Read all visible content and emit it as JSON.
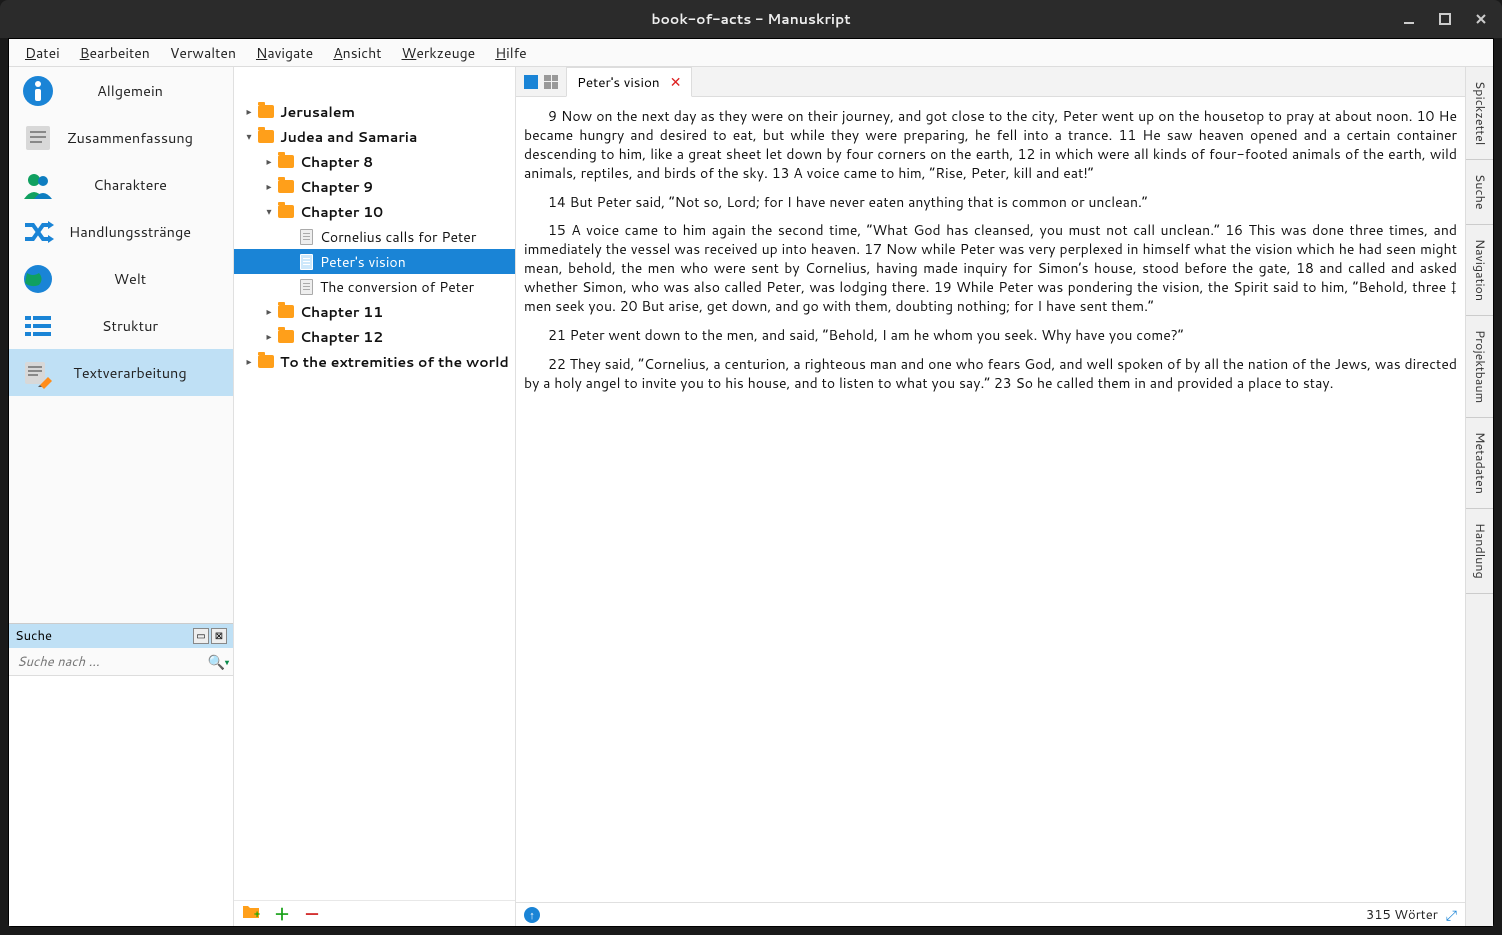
{
  "window": {
    "title": "book-of-acts - Manuskript"
  },
  "menubar": [
    "Datei",
    "Bearbeiten",
    "Verwalten",
    "Navigate",
    "Ansicht",
    "Werkzeuge",
    "Hilfe"
  ],
  "left_nav": {
    "items": [
      {
        "label": "Allgemein",
        "icon": "info"
      },
      {
        "label": "Zusammenfassung",
        "icon": "summary"
      },
      {
        "label": "Charaktere",
        "icon": "people"
      },
      {
        "label": "Handlungsstränge",
        "icon": "shuffle"
      },
      {
        "label": "Welt",
        "icon": "globe"
      },
      {
        "label": "Struktur",
        "icon": "list"
      },
      {
        "label": "Textverarbeitung",
        "icon": "edit"
      }
    ],
    "selected_index": 6
  },
  "search": {
    "title": "Suche",
    "placeholder": "Suche nach ..."
  },
  "tree": [
    {
      "depth": 0,
      "exp": "▸",
      "kind": "folder",
      "bold": true,
      "label": "Jerusalem"
    },
    {
      "depth": 0,
      "exp": "▾",
      "kind": "folder",
      "bold": true,
      "label": "Judea and Samaria"
    },
    {
      "depth": 1,
      "exp": "▸",
      "kind": "folder",
      "bold": true,
      "label": "Chapter 8"
    },
    {
      "depth": 1,
      "exp": "▸",
      "kind": "folder",
      "bold": true,
      "label": "Chapter 9"
    },
    {
      "depth": 1,
      "exp": "▾",
      "kind": "folder",
      "bold": true,
      "label": "Chapter 10"
    },
    {
      "depth": 2,
      "exp": "",
      "kind": "doc",
      "bold": false,
      "label": "Cornelius calls for Peter"
    },
    {
      "depth": 2,
      "exp": "",
      "kind": "doc",
      "bold": false,
      "label": "Peter's vision",
      "selected": true
    },
    {
      "depth": 2,
      "exp": "",
      "kind": "doc",
      "bold": false,
      "label": "The conversion of Peter"
    },
    {
      "depth": 1,
      "exp": "▸",
      "kind": "folder",
      "bold": true,
      "label": "Chapter 11"
    },
    {
      "depth": 1,
      "exp": "▸",
      "kind": "folder",
      "bold": true,
      "label": "Chapter 12"
    },
    {
      "depth": 0,
      "exp": "▸",
      "kind": "folder",
      "bold": true,
      "label": "To the extremities of the world"
    }
  ],
  "tab": {
    "title": "Peter's vision"
  },
  "editor": {
    "paragraphs": [
      "9 Now on the next day as they were on their journey, and got close to the city, Peter went up on the housetop to pray at about noon. 10 He became hungry and desired to eat, but while they were preparing, he fell into a trance. 11 He saw heaven opened and a certain container descending to him, like a great sheet let down by four corners on the earth, 12 in which were all kinds of four-footed animals of the earth, wild animals, reptiles, and birds of the sky. 13 A voice came to him, “Rise, Peter, kill and eat!”",
      "14 But Peter said, “Not so, Lord; for I have never eaten anything that is common or unclean.”",
      "15 A voice came to him again the second time, “What God has cleansed, you must not call unclean.” 16 This was done three times, and immediately the vessel was received up into heaven. 17 Now while Peter was very perplexed in himself what the vision which he had seen might mean, behold, the men who were sent by Cornelius, having made inquiry for Simon’s house, stood before the gate, 18 and called and asked whether Simon, who was also called Peter, was lodging there. 19 While Peter was pondering the vision, the Spirit said to him, “Behold, three ‡ men seek you. 20 But arise, get down, and go with them, doubting nothing; for I have sent them.”",
      "21 Peter went down to the men, and said, “Behold, I am he whom you seek. Why have you come?”",
      "22 They said, “Cornelius, a centurion, a righteous man and one who fears God, and well spoken of by all the nation of the Jews, was directed by a holy angel to invite you to his house, and to listen to what you say.” 23 So he called them in and provided a place to stay."
    ]
  },
  "status": {
    "words": "315 Wörter"
  },
  "right_rail": [
    "Spickzettel",
    "Suche",
    "Navigation",
    "Projektbaum",
    "Metadaten",
    "Handlung"
  ]
}
